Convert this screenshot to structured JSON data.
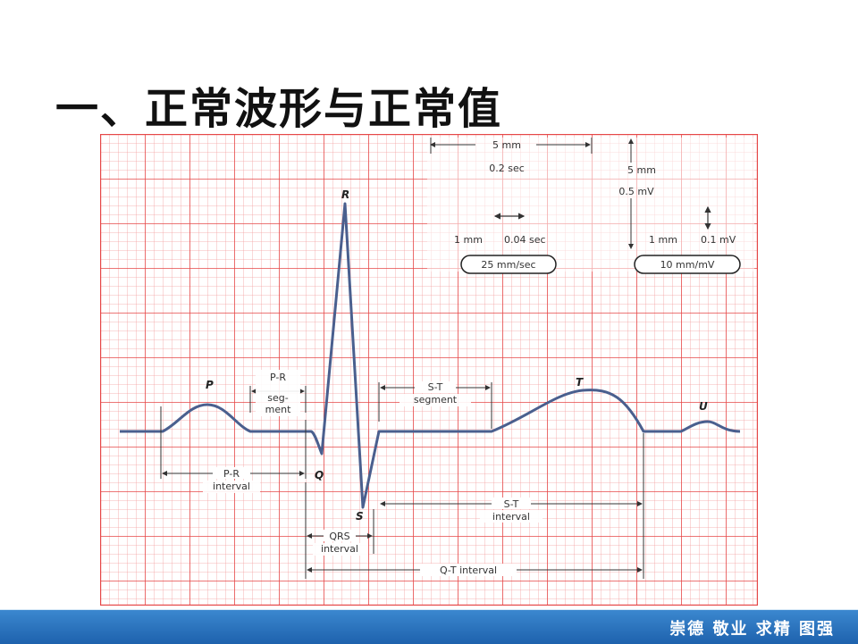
{
  "slide": {
    "title": "一、正常波形与正常值",
    "footer_motto": "崇德 敬业 求精 图强"
  },
  "colors": {
    "grid_minor": "#f4a0a0",
    "grid_major": "#e64848",
    "trace": "#4a5f8e",
    "annotation": "#333333",
    "footer": "#2a73bd"
  },
  "ecg": {
    "waves": {
      "p": "P",
      "q": "Q",
      "r": "R",
      "s": "S",
      "t": "T",
      "u": "U"
    },
    "segments": {
      "pr_segment": [
        "P-R",
        "seg-",
        "ment"
      ],
      "st_segment": [
        "S-T",
        "segment"
      ]
    },
    "intervals": {
      "pr_interval": [
        "P-R",
        "interval"
      ],
      "qrs_interval": [
        "QRS",
        "interval"
      ],
      "st_interval": [
        "S-T",
        "interval"
      ],
      "qt_interval": "Q-T  interval"
    },
    "calibration": {
      "big_box_width": "5 mm",
      "big_box_time": "0.2 sec",
      "small_box_width": "1 mm",
      "small_box_time": "0.04 sec",
      "paper_speed": "25 mm/sec",
      "big_box_height": "5 mm",
      "big_box_voltage": "0.5 mV",
      "small_box_height": "1 mm",
      "small_box_voltage": "0.1 mV",
      "gain": "10 mm/mV"
    }
  }
}
